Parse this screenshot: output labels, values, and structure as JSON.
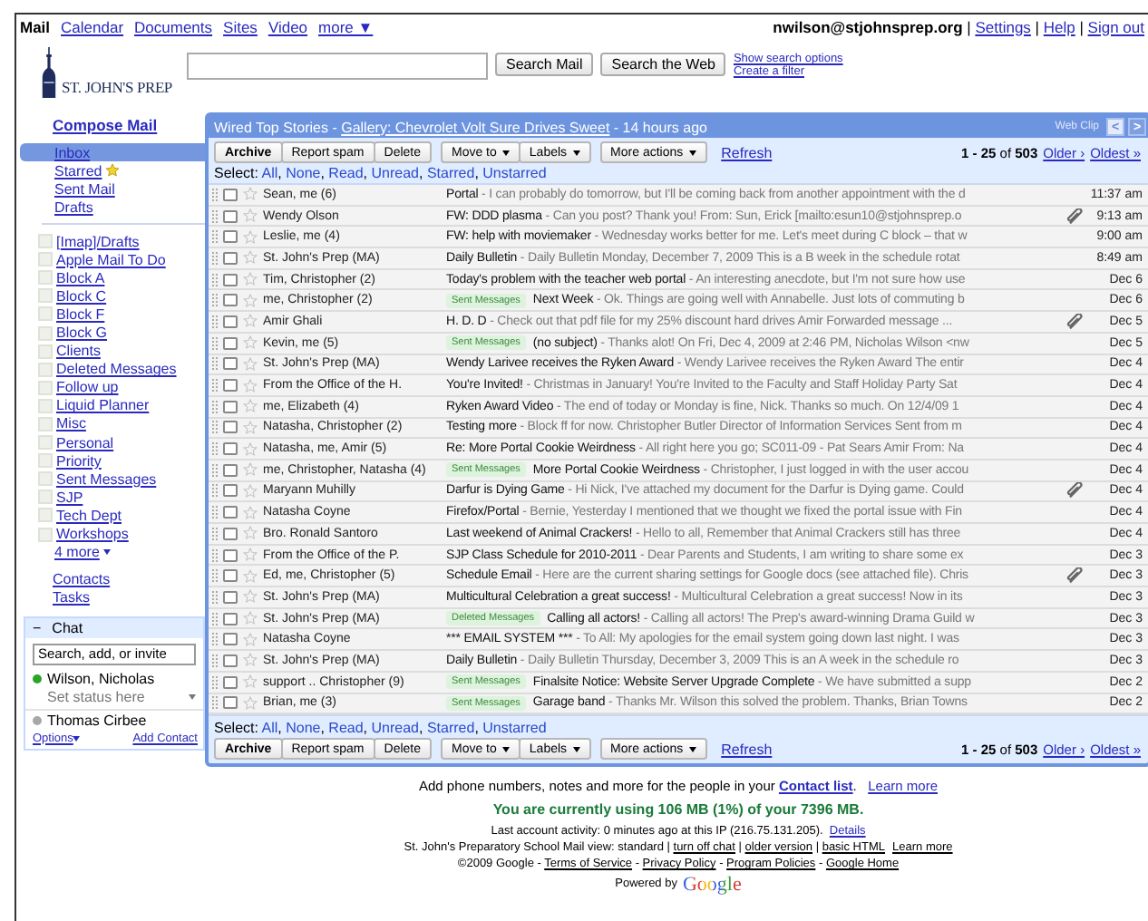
{
  "top_nav": {
    "apps": [
      {
        "label": "Mail",
        "selected": true
      },
      {
        "label": "Calendar",
        "selected": false
      },
      {
        "label": "Documents",
        "selected": false
      },
      {
        "label": "Sites",
        "selected": false
      },
      {
        "label": "Video",
        "selected": false
      },
      {
        "label": "more ▼",
        "selected": false
      }
    ],
    "account": [
      {
        "text": "nwilson@stjohnsprep.org",
        "kind": "bold"
      },
      {
        "text": " | ",
        "kind": "text"
      },
      {
        "text": "Settings",
        "kind": "link"
      },
      {
        "text": " | ",
        "kind": "text"
      },
      {
        "text": "Help",
        "kind": "link"
      },
      {
        "text": " | ",
        "kind": "text"
      },
      {
        "text": "Sign out",
        "kind": "link"
      }
    ]
  },
  "logo": {
    "text": "ST. JOHN'S PREP"
  },
  "search": {
    "buttons": [
      "Search Mail",
      "Search the Web"
    ],
    "links": [
      "Show search options",
      "Create a filter"
    ]
  },
  "sidebar": {
    "compose": "Compose Mail",
    "folders": [
      {
        "label": "Inbox",
        "selected": true,
        "kind": "plain"
      },
      {
        "label": "Starred",
        "selected": false,
        "kind": "star"
      },
      {
        "label": "Sent Mail",
        "selected": false,
        "kind": "plain"
      },
      {
        "label": "Drafts",
        "selected": false,
        "kind": "plain"
      }
    ],
    "labels": [
      "[Imap]/Drafts",
      "Apple Mail To Do",
      "Block A",
      "Block C",
      "Block F",
      "Block G",
      "Clients",
      "Deleted Messages",
      "Follow up",
      "Liquid Planner",
      "Misc",
      "Personal",
      "Priority",
      "Sent Messages",
      "SJP",
      "Tech Dept",
      "Workshops"
    ],
    "more": "4 more",
    "links": [
      "Contacts",
      "Tasks"
    ]
  },
  "chat": {
    "collapse": "−",
    "title": "Chat",
    "search": {
      "placeholder": "Search, add, or invite"
    },
    "contacts": [
      {
        "name": "Wilson, Nicholas",
        "status": "Set status here",
        "color": "#2aa52a"
      },
      {
        "name": "Thomas Cirbee",
        "color": "#a8a8a8"
      }
    ],
    "options": "Options",
    "add": "Add Contact"
  },
  "webclip": {
    "headline": [
      {
        "text": "Wired Top Stories - ",
        "kind": "text"
      },
      {
        "text": "Gallery: Chevrolet Volt Sure Drives Sweet",
        "kind": "link"
      },
      {
        "text": " - 14 hours ago",
        "kind": "text"
      }
    ],
    "label": "Web Clip",
    "prev": {
      "text": "<",
      "disabled": true
    },
    "next": {
      "text": ">",
      "disabled": false
    }
  },
  "top": {
    "toolbar": [
      [
        {
          "label": "Archive",
          "kind": "plain"
        },
        {
          "label": "Report spam",
          "kind": "plain"
        },
        {
          "label": "Delete",
          "kind": "plain"
        }
      ],
      [
        {
          "label": "Move to",
          "kind": "menu"
        },
        {
          "label": "Labels",
          "kind": "menu"
        }
      ],
      [
        {
          "label": "More actions",
          "kind": "menu"
        }
      ]
    ],
    "refresh": "Refresh",
    "pager": {
      "range": "**1 - 25** of **503**",
      "older": "Older ›",
      "oldest": "Oldest »"
    },
    "select": [
      {
        "text": "Select: ",
        "kind": "text"
      },
      {
        "text": "All",
        "kind": "link"
      },
      {
        "text": ", ",
        "kind": "text"
      },
      {
        "text": "None",
        "kind": "link"
      },
      {
        "text": ", ",
        "kind": "text"
      },
      {
        "text": "Read",
        "kind": "link"
      },
      {
        "text": ", ",
        "kind": "text"
      },
      {
        "text": "Unread",
        "kind": "link"
      },
      {
        "text": ", ",
        "kind": "text"
      },
      {
        "text": "Starred",
        "kind": "link"
      },
      {
        "text": ", ",
        "kind": "text"
      },
      {
        "text": "Unstarred",
        "kind": "link"
      }
    ]
  },
  "messages": [
    {
      "sender": "Sean, me (6)",
      "subject": "Portal",
      "preview": " - I can probably do tomorrow, but I'll be coming back from another appointment with the d",
      "date": "11:37 am",
      "attachment": false,
      "checked": false,
      "starred": false
    },
    {
      "sender": "Wendy Olson",
      "subject": "FW: DDD plasma",
      "preview": " - Can you post? Thank you! From: Sun, Erick [mailto:esun10@stjohnsprep.o",
      "date": "9:13 am",
      "attachment": true,
      "checked": false,
      "starred": false
    },
    {
      "sender": "Leslie, me (4)",
      "subject": "FW: help with moviemaker",
      "preview": " - Wednesday works better for me. Let's meet during C block – that w",
      "date": "9:00 am",
      "attachment": false,
      "checked": false,
      "starred": false
    },
    {
      "sender": "St. John's Prep (MA)",
      "subject": "Daily Bulletin",
      "preview": " - Daily Bulletin Monday, December 7, 2009 This is a B week in the schedule rotat",
      "date": "8:49 am",
      "attachment": false,
      "checked": false,
      "starred": false
    },
    {
      "sender": "Tim, Christopher (2)",
      "subject": "Today's problem with the teacher web portal",
      "preview": " - An interesting anecdote, but I'm not sure how use",
      "date": "Dec 6",
      "attachment": false,
      "checked": false,
      "starred": false
    },
    {
      "sender": "me, Christopher (2)",
      "label": "Sent Messages",
      "subject": "Next Week",
      "preview": " - Ok. Things are going well with Annabelle. Just lots of commuting b",
      "date": "Dec 6",
      "attachment": false,
      "checked": false,
      "starred": false
    },
    {
      "sender": "Amir Ghali",
      "subject": "H. D. D",
      "preview": " - Check out that pdf file for my 25% discount hard drives Amir Forwarded message ...",
      "date": "Dec 5",
      "attachment": true,
      "checked": false,
      "starred": false
    },
    {
      "sender": "Kevin, me (5)",
      "label": "Sent Messages",
      "subject": "(no subject)",
      "preview": " - Thanks alot! On Fri, Dec 4, 2009 at 2:46 PM, Nicholas Wilson <nw",
      "date": "Dec 5",
      "attachment": false,
      "checked": false,
      "starred": false
    },
    {
      "sender": "St. John's Prep (MA)",
      "subject": "Wendy Larivee receives the Ryken Award",
      "preview": " - Wendy Larivee receives the Ryken Award The entir",
      "date": "Dec 4",
      "attachment": false,
      "checked": false,
      "starred": false
    },
    {
      "sender": "From the Office of the H.",
      "subject": "You're Invited!",
      "preview": " - Christmas in January! You're Invited to the Faculty and Staff Holiday Party Sat",
      "date": "Dec 4",
      "attachment": false,
      "checked": false,
      "starred": false
    },
    {
      "sender": "me, Elizabeth (4)",
      "subject": "Ryken Award Video",
      "preview": " - The end of today or Monday is fine, Nick. Thanks so much. On 12/4/09 1",
      "date": "Dec 4",
      "attachment": false,
      "checked": false,
      "starred": false
    },
    {
      "sender": "Natasha, Christopher (2)",
      "subject": "Testing more",
      "preview": " - Block ff for now. Christopher Butler Director of Information Services Sent from m",
      "date": "Dec 4",
      "attachment": false,
      "checked": false,
      "starred": false
    },
    {
      "sender": "Natasha, me, Amir (5)",
      "subject": "Re: More Portal Cookie Weirdness",
      "preview": " - All right here you go; SC011-09 - Pat Sears Amir From: Na",
      "date": "Dec 4",
      "attachment": false,
      "checked": false,
      "starred": false
    },
    {
      "sender": "me, Christopher, Natasha (4)",
      "label": "Sent Messages",
      "subject": "More Portal Cookie Weirdness",
      "preview": " - Christopher, I just logged in with the user accou",
      "date": "Dec 4",
      "attachment": false,
      "checked": false,
      "starred": false
    },
    {
      "sender": "Maryann Muhilly",
      "subject": "Darfur is Dying Game",
      "preview": " - Hi Nick, I've attached my document for the Darfur is Dying game. Could",
      "date": "Dec 4",
      "attachment": true,
      "checked": false,
      "starred": false
    },
    {
      "sender": "Natasha Coyne",
      "subject": "Firefox/Portal",
      "preview": " - Bernie, Yesterday I mentioned that we thought we fixed the portal issue with Fin",
      "date": "Dec 4",
      "attachment": false,
      "checked": false,
      "starred": false
    },
    {
      "sender": "Bro. Ronald Santoro",
      "subject": "Last weekend of Animal Crackers!",
      "preview": " - Hello to all, Remember that Animal Crackers still has three",
      "date": "Dec 4",
      "attachment": false,
      "checked": false,
      "starred": false
    },
    {
      "sender": "From the Office of the P.",
      "subject": "SJP Class Schedule for 2010-2011",
      "preview": " - Dear Parents and Students, I am writing to share some ex",
      "date": "Dec 3",
      "attachment": false,
      "checked": false,
      "starred": false
    },
    {
      "sender": "Ed, me, Christopher (5)",
      "subject": "Schedule Email",
      "preview": " - Here are the current sharing settings for Google docs (see attached file). Chris",
      "date": "Dec 3",
      "attachment": true,
      "checked": false,
      "starred": false
    },
    {
      "sender": "St. John's Prep (MA)",
      "subject": "Multicultural Celebration a great success!",
      "preview": " - Multicultural Celebration a great success! Now in its",
      "date": "Dec 3",
      "attachment": false,
      "checked": false,
      "starred": false
    },
    {
      "sender": "St. John's Prep (MA)",
      "label": "Deleted Messages",
      "subject": "Calling all actors!",
      "preview": " - Calling all actors! The Prep's award-winning Drama Guild w",
      "date": "Dec 3",
      "attachment": false,
      "checked": false,
      "starred": false
    },
    {
      "sender": "Natasha Coyne",
      "subject": "*** EMAIL SYSTEM ***",
      "preview": " - To All: My apologies for the email system going down last night. I was",
      "date": "Dec 3",
      "attachment": false,
      "checked": false,
      "starred": false
    },
    {
      "sender": "St. John's Prep (MA)",
      "subject": "Daily Bulletin",
      "preview": " - Daily Bulletin Thursday, December 3, 2009 This is an A week in the schedule ro",
      "date": "Dec 3",
      "attachment": false,
      "checked": false,
      "starred": false
    },
    {
      "sender": "support .. Christopher (9)",
      "label": "Sent Messages",
      "subject": "Finalsite Notice: Website Server Upgrade Complete",
      "preview": " - We have submitted a supp",
      "date": "Dec 2",
      "attachment": false,
      "checked": false,
      "starred": false
    },
    {
      "sender": "Brian, me (3)",
      "label": "Sent Messages",
      "subject": "Garage band",
      "preview": " - Thanks Mr. Wilson this solved the problem. Thanks, Brian Towns",
      "date": "Dec 2",
      "attachment": false,
      "checked": false,
      "starred": false
    }
  ],
  "bottom": {
    "select": [
      {
        "text": "Select: ",
        "kind": "text"
      },
      {
        "text": "All",
        "kind": "link"
      },
      {
        "text": ", ",
        "kind": "text"
      },
      {
        "text": "None",
        "kind": "link"
      },
      {
        "text": ", ",
        "kind": "text"
      },
      {
        "text": "Read",
        "kind": "link"
      },
      {
        "text": ", ",
        "kind": "text"
      },
      {
        "text": "Unread",
        "kind": "link"
      },
      {
        "text": ", ",
        "kind": "text"
      },
      {
        "text": "Starred",
        "kind": "link"
      },
      {
        "text": ", ",
        "kind": "text"
      },
      {
        "text": "Unstarred",
        "kind": "link"
      }
    ],
    "toolbar": [
      [
        {
          "label": "Archive",
          "kind": "plain"
        },
        {
          "label": "Report spam",
          "kind": "plain"
        },
        {
          "label": "Delete",
          "kind": "plain"
        }
      ],
      [
        {
          "label": "Move to",
          "kind": "menu"
        },
        {
          "label": "Labels",
          "kind": "menu"
        }
      ],
      [
        {
          "label": "More actions",
          "kind": "menu"
        }
      ]
    ],
    "refresh": "Refresh",
    "pager": {
      "range": "**1 - 25** of **503**",
      "older": "Older ›",
      "oldest": "Oldest »"
    }
  },
  "footer": {
    "lines": [
      {
        "kind": "plain",
        "parts": [
          {
            "text": "Add phone numbers, notes and more for the people in your ",
            "kind": "text"
          },
          {
            "text": "Contact list",
            "kind": "boldlink"
          },
          {
            "text": ".   ",
            "kind": "text"
          },
          {
            "text": "Learn more",
            "kind": "link"
          }
        ]
      },
      {
        "kind": "quota",
        "parts": [
          {
            "text": "You are currently using 106 MB (1%) of your 7396 MB.",
            "kind": "text"
          }
        ]
      },
      {
        "kind": "small",
        "parts": [
          {
            "text": "Last account activity: 0 minutes ago at this IP (216.75.131.205).  ",
            "kind": "text"
          },
          {
            "text": "Details",
            "kind": "link"
          }
        ]
      },
      {
        "kind": "small",
        "parts": [
          {
            "text": "St. John's Preparatory School Mail view: standard | ",
            "kind": "text"
          },
          {
            "text": "turn off chat",
            "kind": "darklink"
          },
          {
            "text": " | ",
            "kind": "text"
          },
          {
            "text": "older version",
            "kind": "darklink"
          },
          {
            "text": " | ",
            "kind": "text"
          },
          {
            "text": "basic HTML",
            "kind": "darklink"
          },
          {
            "text": "Learn more",
            "kind": "gaplink"
          }
        ]
      },
      {
        "kind": "small",
        "parts": [
          {
            "text": "©2009 Google - ",
            "kind": "text"
          },
          {
            "text": "Terms of Service",
            "kind": "darklink"
          },
          {
            "text": " - ",
            "kind": "text"
          },
          {
            "text": "Privacy Policy",
            "kind": "darklink"
          },
          {
            "text": " - ",
            "kind": "text"
          },
          {
            "text": "Program Policies",
            "kind": "darklink"
          },
          {
            "text": " - ",
            "kind": "text"
          },
          {
            "text": "Google Home",
            "kind": "darklink"
          }
        ]
      }
    ],
    "powered": "Powered by",
    "brand": "Google"
  }
}
